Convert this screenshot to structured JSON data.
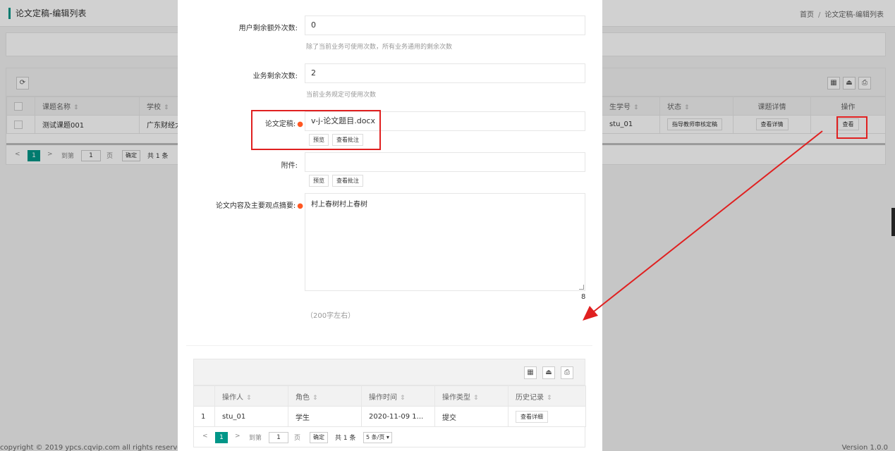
{
  "page": {
    "title": "论文定稿-编辑列表",
    "breadcrumb": [
      "首页",
      "论文定稿-编辑列表"
    ],
    "breadcrumb_sep": "/",
    "footer_left": "copyright © 2019 ypcs.cqvip.com all rights reserved",
    "footer_right": "Version 1.0.0"
  },
  "list_table": {
    "headers": [
      "课题名称",
      "学校",
      "生学号",
      "状态",
      "课题详情",
      "操作"
    ],
    "rows": [
      {
        "title": "测试课题001",
        "school": "广东财经大学",
        "student_no": "stu_01",
        "status": "指导教师审核定稿",
        "detail_button": "查看详情",
        "action_button": "查看"
      }
    ],
    "pager": {
      "current": "1",
      "goto": "到第",
      "page_input": "1",
      "page_unit": "页",
      "confirm": "确定",
      "total": "共 1 条"
    }
  },
  "icons": {
    "refresh": "refresh-icon",
    "columns": "columns-icon",
    "export": "export-icon",
    "print": "print-icon",
    "sort": "sort-icon",
    "dropdown": "dropdown-caret-icon"
  },
  "form": {
    "extra_label": "用户剩余额外次数:",
    "extra_value": "0",
    "extra_hint": "除了当前业务可使用次数，所有业务通用的剩余次数",
    "biz_label": "业务剩余次数:",
    "biz_value": "2",
    "biz_hint": "当前业务规定可使用次数",
    "thesis_label": "论文定稿:",
    "thesis_value": "v-j-论文题目.docx",
    "preview_button": "预览",
    "comments_button": "查看批注",
    "attach_label": "附件:",
    "attach_value": "",
    "abstract_label": "论文内容及主要观点摘要:",
    "abstract_value": "村上春树村上春树",
    "char_count": "8",
    "abstract_hint": "（200字左右）"
  },
  "history": {
    "headers": [
      "",
      "操作人",
      "角色",
      "操作时间",
      "操作类型",
      "历史记录"
    ],
    "rows": [
      {
        "index": "1",
        "operator": "stu_01",
        "role": "学生",
        "time": "2020-11-09 1...",
        "type": "提交",
        "button": "查看详细"
      }
    ],
    "pager": {
      "current": "1",
      "goto": "到第",
      "page_input": "1",
      "page_unit": "页",
      "confirm": "确定",
      "total": "共 1 条",
      "page_size": "5 条/页"
    }
  },
  "colors": {
    "accent": "#009688",
    "highlight": "#e02020",
    "required": "#ff5722"
  }
}
